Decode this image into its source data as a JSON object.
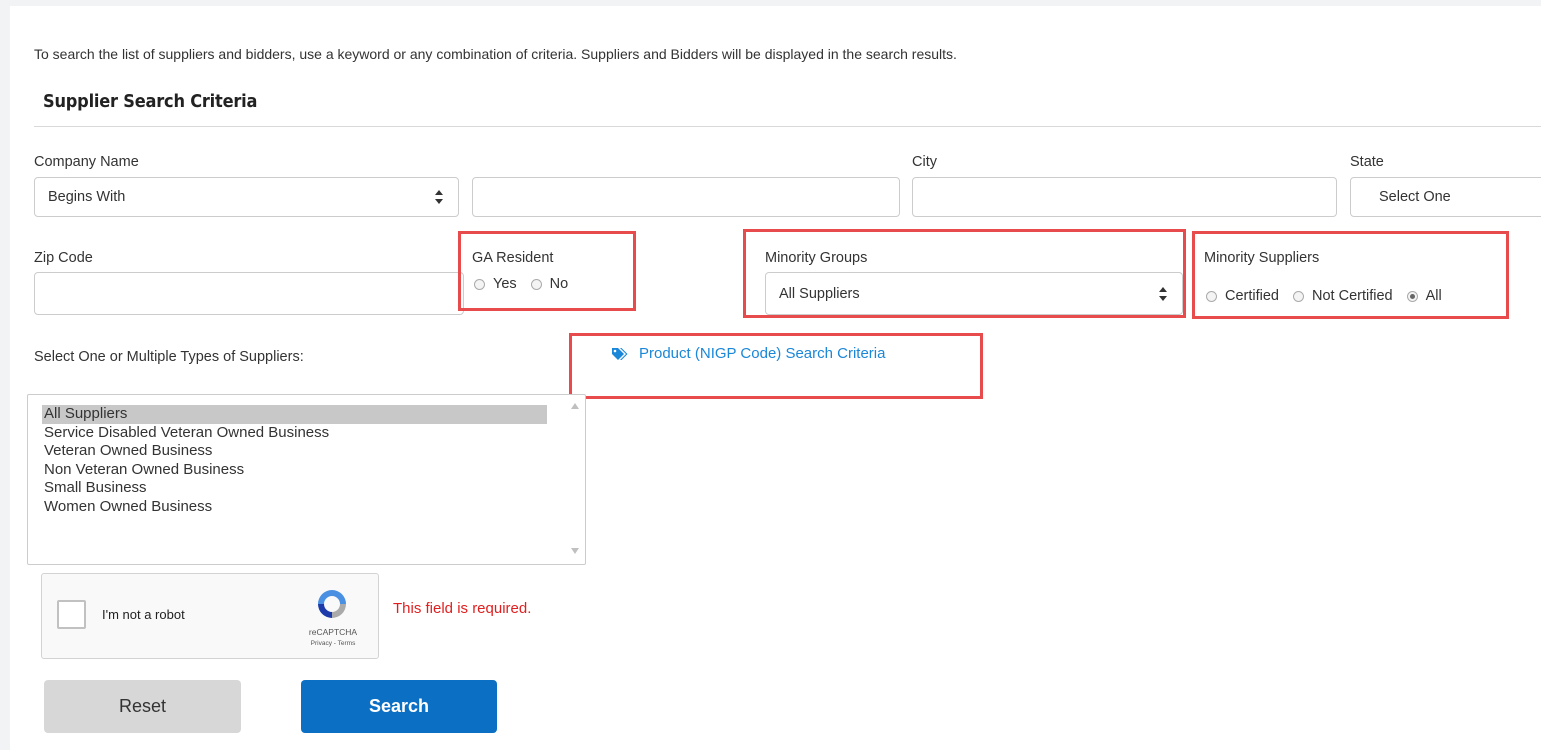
{
  "intro_text": "To search the list of suppliers and bidders, use a keyword or any combination of criteria. Suppliers and Bidders will be displayed in the search results.",
  "section_title": "Supplier Search Criteria",
  "company_name": {
    "label": "Company Name",
    "match_value": "Begins With",
    "text_value": ""
  },
  "city": {
    "label": "City",
    "value": ""
  },
  "state": {
    "label": "State",
    "value": "Select One"
  },
  "zip": {
    "label": "Zip Code",
    "value": ""
  },
  "ga_resident": {
    "label": "GA Resident",
    "options": [
      "Yes",
      "No"
    ],
    "selected": null
  },
  "minority_groups": {
    "label": "Minority Groups",
    "value": "All Suppliers"
  },
  "minority_suppliers": {
    "label": "Minority Suppliers",
    "options": [
      "Certified",
      "Not Certified",
      "All"
    ],
    "selected": "All"
  },
  "supplier_types": {
    "label": "Select One or Multiple Types of Suppliers:",
    "items": [
      "All Suppliers",
      "Service Disabled Veteran Owned Business",
      "Veteran Owned Business",
      "Non Veteran Owned Business",
      "Small Business",
      "Women Owned Business"
    ],
    "selected": "All Suppliers"
  },
  "nigp_link": "Product (NIGP Code) Search Criteria",
  "captcha": {
    "label": "I'm not a robot",
    "brand": "reCAPTCHA",
    "terms": "Privacy - Terms",
    "error": "This field is required."
  },
  "buttons": {
    "reset": "Reset",
    "search": "Search"
  },
  "colors": {
    "highlight_box": "#e84b4b",
    "primary_button": "#0b6fc4",
    "link": "#1a87d8",
    "error": "#e02020"
  }
}
